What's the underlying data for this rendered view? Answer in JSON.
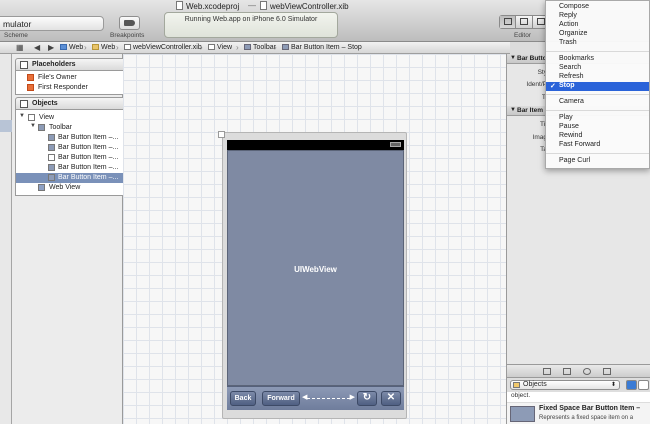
{
  "toolbar": {
    "scheme_text": "mulator",
    "scheme_label": "Scheme",
    "breakpoints_label": "Breakpoints",
    "editor_label": "Editor",
    "title_left": "Web.xcodeproj",
    "title_sep": "—",
    "title_right": "webViewController.xib",
    "activity_status": "Running Web.app on iPhone 6.0 Simulator"
  },
  "jumpbar": {
    "crumbs": [
      "Web",
      "Web",
      "webViewController.xib",
      "View",
      "Toolbar",
      "Bar Button Item – Stop"
    ]
  },
  "outline": {
    "placeholders_title": "Placeholders",
    "placeholders": [
      "File's Owner",
      "First Responder"
    ],
    "objects_title": "Objects",
    "objects": [
      {
        "label": "View",
        "selected": false
      },
      {
        "label": "Toolbar",
        "selected": false
      },
      {
        "label": "Bar Button Item –...",
        "selected": false
      },
      {
        "label": "Bar Button Item –...",
        "selected": false
      },
      {
        "label": "Bar Button Item –...",
        "selected": false
      },
      {
        "label": "Bar Button Item –...",
        "selected": false
      },
      {
        "label": "Bar Button Item –...",
        "selected": true
      },
      {
        "label": "Web View",
        "selected": false
      }
    ]
  },
  "canvas": {
    "webview_label": "UIWebView",
    "toolbar_buttons": [
      "Back",
      "Forward"
    ]
  },
  "inspector": {
    "section1": "Bar Butto",
    "rows1": [
      "Sty",
      "Ident/P",
      "Ti"
    ],
    "section2": "Bar Item",
    "rows2": [
      "Tit",
      "Imag",
      "Ta"
    ]
  },
  "library": {
    "selected": "Objects",
    "prev_item_text": "object.",
    "item_title": "Fixed Space Bar Button Item –",
    "item_desc": "Represents a fixed space item on a"
  },
  "menu": {
    "items": [
      "Compose",
      "Reply",
      "Action",
      "Organize",
      "Trash",
      "Bookmarks",
      "Search",
      "Refresh",
      "Stop",
      "Camera",
      "Play",
      "Pause",
      "Rewind",
      "Fast Forward",
      "Page Curl"
    ],
    "checked": "Stop",
    "check_mark": "✓"
  },
  "colors": {
    "selection": "#7a91b9",
    "menu_highlight": "#2a63d9",
    "webview": "#7f8aa3"
  }
}
